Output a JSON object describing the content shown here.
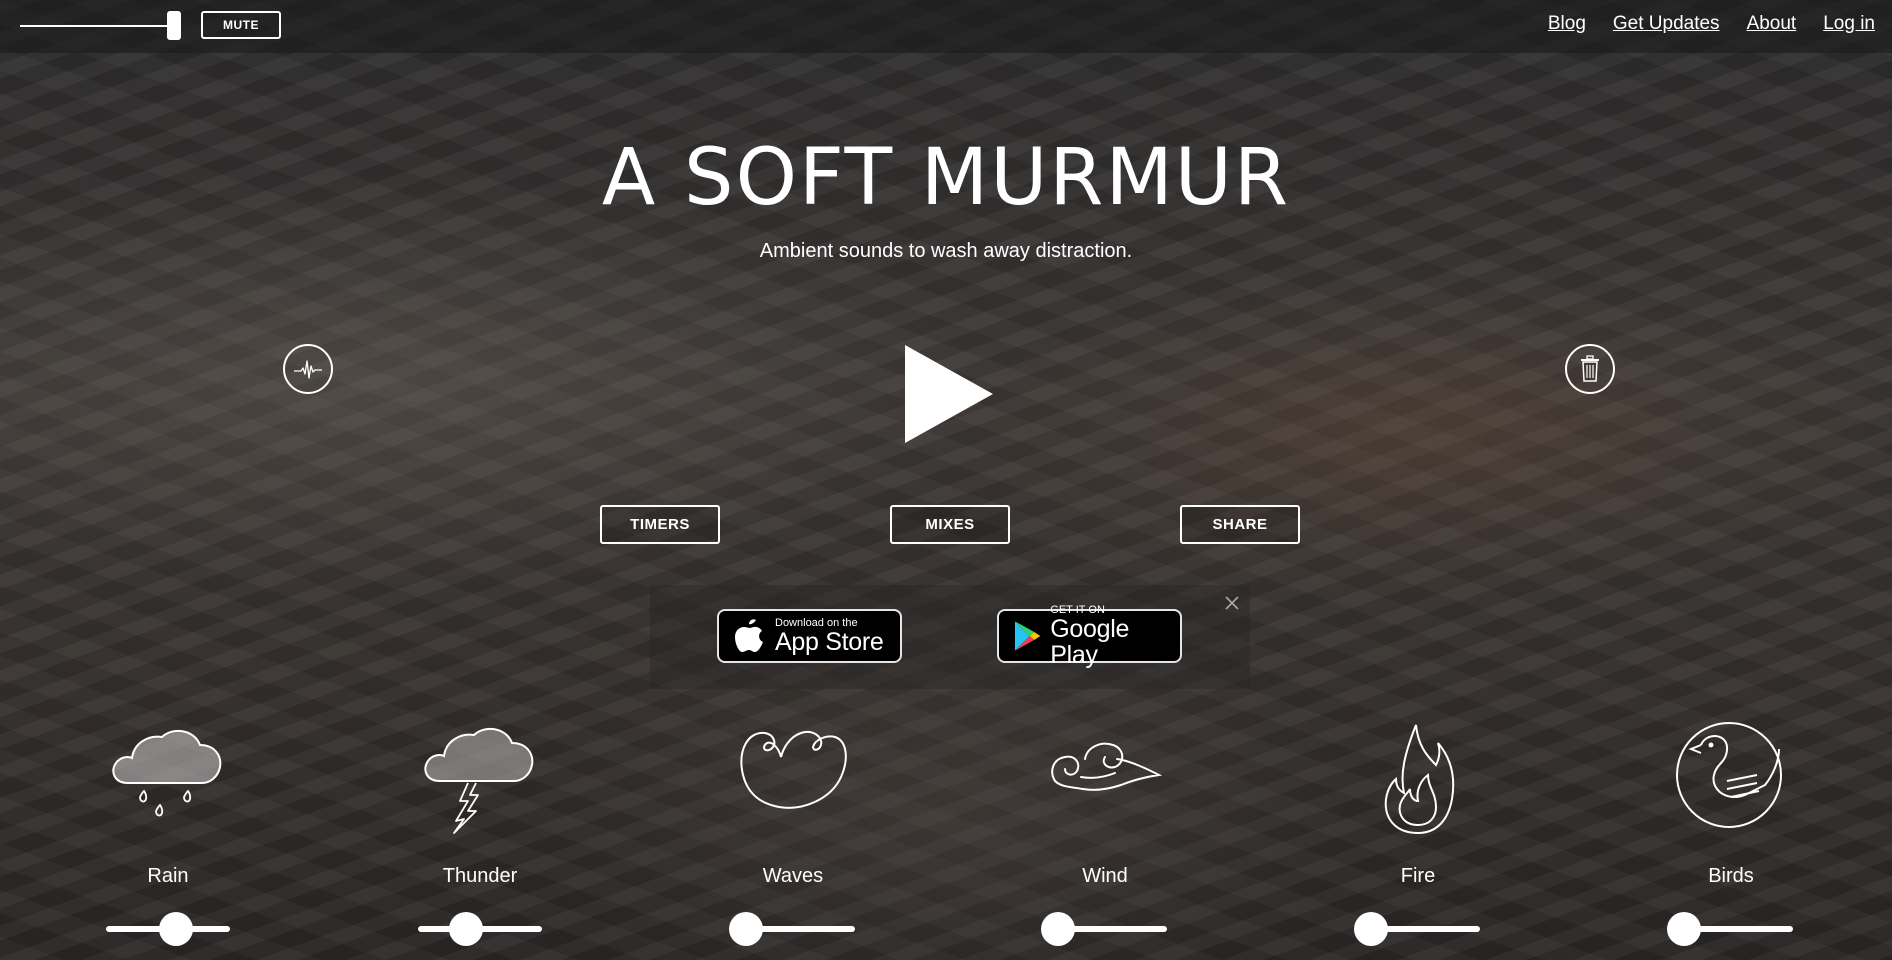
{
  "topbar": {
    "mute_label": "MUTE",
    "master_volume": 1.0,
    "nav": [
      "Blog",
      "Get Updates",
      "About",
      "Log in"
    ]
  },
  "hero": {
    "title": "A SOFT MURMUR",
    "subtitle": "Ambient sounds to wash away distraction."
  },
  "icons": {
    "left_round": "waveform-icon",
    "right_round": "trash-icon",
    "center": "play-icon"
  },
  "actions": [
    "TIMERS",
    "MIXES",
    "SHARE"
  ],
  "app_banner": {
    "apple": {
      "small": "Download on the",
      "big": "App Store"
    },
    "google": {
      "small": "GET IT ON",
      "big": "Google Play"
    }
  },
  "sounds": [
    {
      "label": "Rain",
      "icon": "rain-cloud-icon",
      "volume": 0.58
    },
    {
      "label": "Thunder",
      "icon": "thunder-cloud-icon",
      "volume": 0.35
    },
    {
      "label": "Waves",
      "icon": "waves-icon",
      "volume": 0.0
    },
    {
      "label": "Wind",
      "icon": "wind-icon",
      "volume": 0.0
    },
    {
      "label": "Fire",
      "icon": "fire-icon",
      "volume": 0.0
    },
    {
      "label": "Birds",
      "icon": "bird-icon",
      "volume": 0.0
    }
  ],
  "colors": {
    "text": "#ffffff",
    "topbar": "#191919"
  }
}
